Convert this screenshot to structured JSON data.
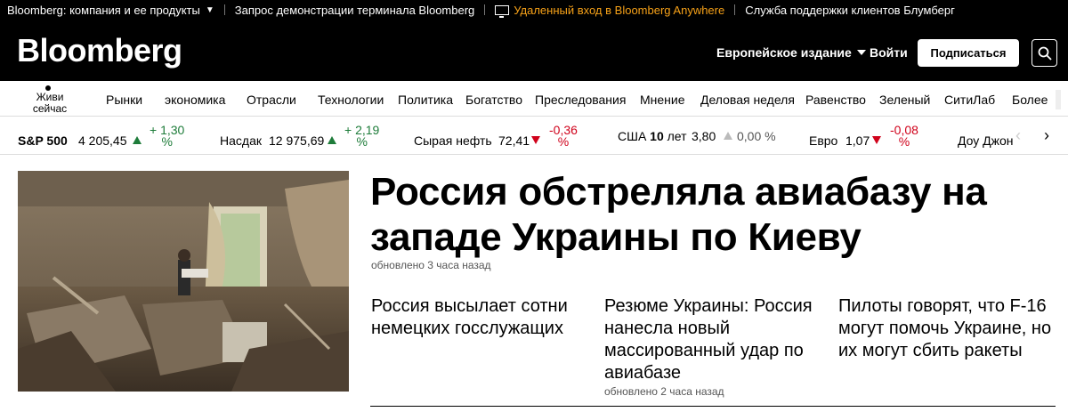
{
  "utility_bar": {
    "company": "Bloomberg: компания и ее продукты",
    "demo": "Запрос демонстрации терминала Bloomberg",
    "anywhere": "Удаленный вход в Bloomberg Anywhere",
    "support": "Служба поддержки клиентов Блумберг"
  },
  "masthead": {
    "logo": "Bloomberg",
    "edition": "Европейское издание",
    "login": "Войти",
    "subscribe": "Подписаться"
  },
  "nav": {
    "live_line1": "Живи",
    "live_line2": "сейчас",
    "items": [
      "Рынки",
      "экономика",
      "Отрасли",
      "Технологии",
      "Политика",
      "Богатство",
      "Преследования",
      "Мнение",
      "Деловая неделя",
      "Равенство",
      "Зеленый",
      "СитиЛаб",
      "Более"
    ]
  },
  "ticker": [
    {
      "name": "S&P 500",
      "value": "4 205,45",
      "change_line1": "+ 1,30",
      "change_line2": "%",
      "direction": "up"
    },
    {
      "name": "Насдак",
      "value": "12 975,69",
      "change_line1": "+ 2,19",
      "change_line2": "%",
      "direction": "up"
    },
    {
      "name": "Сырая нефть",
      "value": "72,41",
      "change_line1": "-0,36",
      "change_line2": "%",
      "direction": "down"
    },
    {
      "name": "США",
      "name_bold": "10",
      "name_suffix": "лет",
      "value": "3,80",
      "change": "0,00 %",
      "direction": "flat"
    },
    {
      "name": "Евро",
      "value": "1,07",
      "change_line1": "-0,08",
      "change_line2": "%",
      "direction": "down"
    },
    {
      "name": "Доу Джон"
    }
  ],
  "main": {
    "headline": "Россия обстреляла авиабазу на западе Украины по Киеву",
    "updated": "обновлено 3 часа назад",
    "stories": [
      {
        "title": "Россия высылает сотни немецких госслужащих"
      },
      {
        "title": "Резюме Украины: Россия нанесла новый массированный удар по авиабазе",
        "updated": "обновлено 2 часа назад"
      },
      {
        "title": "Пилоты говорят, что F-16 могут помочь Украине, но их могут сбить ракеты"
      }
    ]
  },
  "colors": {
    "positive": "#1e7c3a",
    "negative": "#d0021b",
    "anywhere": "#f6a118"
  }
}
